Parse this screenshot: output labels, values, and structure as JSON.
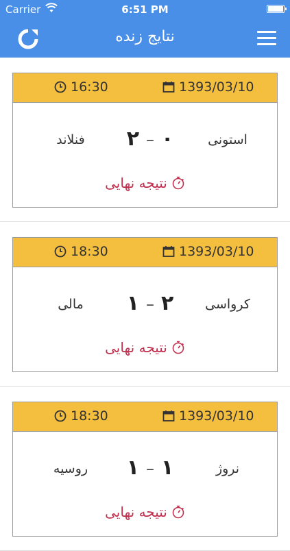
{
  "statusbar": {
    "carrier": "Carrier",
    "time": "6:51 PM"
  },
  "navbar": {
    "title": "نتایج زنده"
  },
  "colors": {
    "accent": "#4A8FE7",
    "card_header": "#F4BE3F",
    "status": "#C1304F"
  },
  "matches": [
    {
      "time": "16:30",
      "date": "1393/03/10",
      "home": "استونی",
      "away": "فنلاند",
      "home_score": "۰",
      "away_score": "۲",
      "dash": "–",
      "status": "نتیجه نهایی"
    },
    {
      "time": "18:30",
      "date": "1393/03/10",
      "home": "کرواسی",
      "away": "مالی",
      "home_score": "۲",
      "away_score": "۱",
      "dash": "–",
      "status": "نتیجه نهایی"
    },
    {
      "time": "18:30",
      "date": "1393/03/10",
      "home": "نروژ",
      "away": "روسیه",
      "home_score": "۱",
      "away_score": "۱",
      "dash": "–",
      "status": "نتیجه نهایی"
    }
  ]
}
